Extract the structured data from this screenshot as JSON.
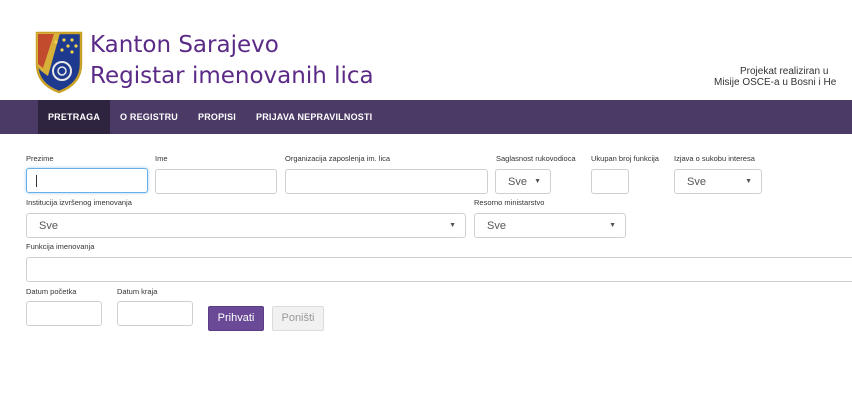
{
  "header": {
    "title_line1": "Kanton Sarajevo",
    "title_line2": "Registar imenovanih lica",
    "project_line1": "Projekat realiziran u",
    "project_line2": "Misije OSCE-a u Bosni i He"
  },
  "nav": {
    "items": [
      {
        "label": "PRETRAGA"
      },
      {
        "label": "O REGISTRU"
      },
      {
        "label": "PROPISI"
      },
      {
        "label": "PRIJAVA NEPRAVILNOSTI"
      }
    ]
  },
  "form": {
    "prezime": {
      "label": "Prezime",
      "value": ""
    },
    "ime": {
      "label": "Ime",
      "value": ""
    },
    "organizacija": {
      "label": "Organizacija zaposlenja im. lica",
      "value": ""
    },
    "saglasnost": {
      "label": "Saglasnost rukovodioca",
      "value": "Sve"
    },
    "ukupan_broj": {
      "label": "Ukupan broj funkcija",
      "value": ""
    },
    "izjava": {
      "label": "Izjava o sukobu interesa",
      "value": "Sve"
    },
    "institucija": {
      "label": "Institucija izvršenog imenovanja",
      "value": "Sve"
    },
    "resorno": {
      "label": "Resorno ministarstvo",
      "value": "Sve"
    },
    "funkcija": {
      "label": "Funkcija imenovanja",
      "value": ""
    },
    "datum_pocetka": {
      "label": "Datum početka",
      "value": ""
    },
    "datum_kraja": {
      "label": "Datum kraja",
      "value": ""
    },
    "submit_label": "Prihvati",
    "reset_label": "Poništi"
  },
  "colors": {
    "brand_purple": "#5b2a86",
    "nav_bg": "#4b3a66",
    "nav_active_bg": "#2f2440",
    "button_primary": "#6a4a96"
  }
}
